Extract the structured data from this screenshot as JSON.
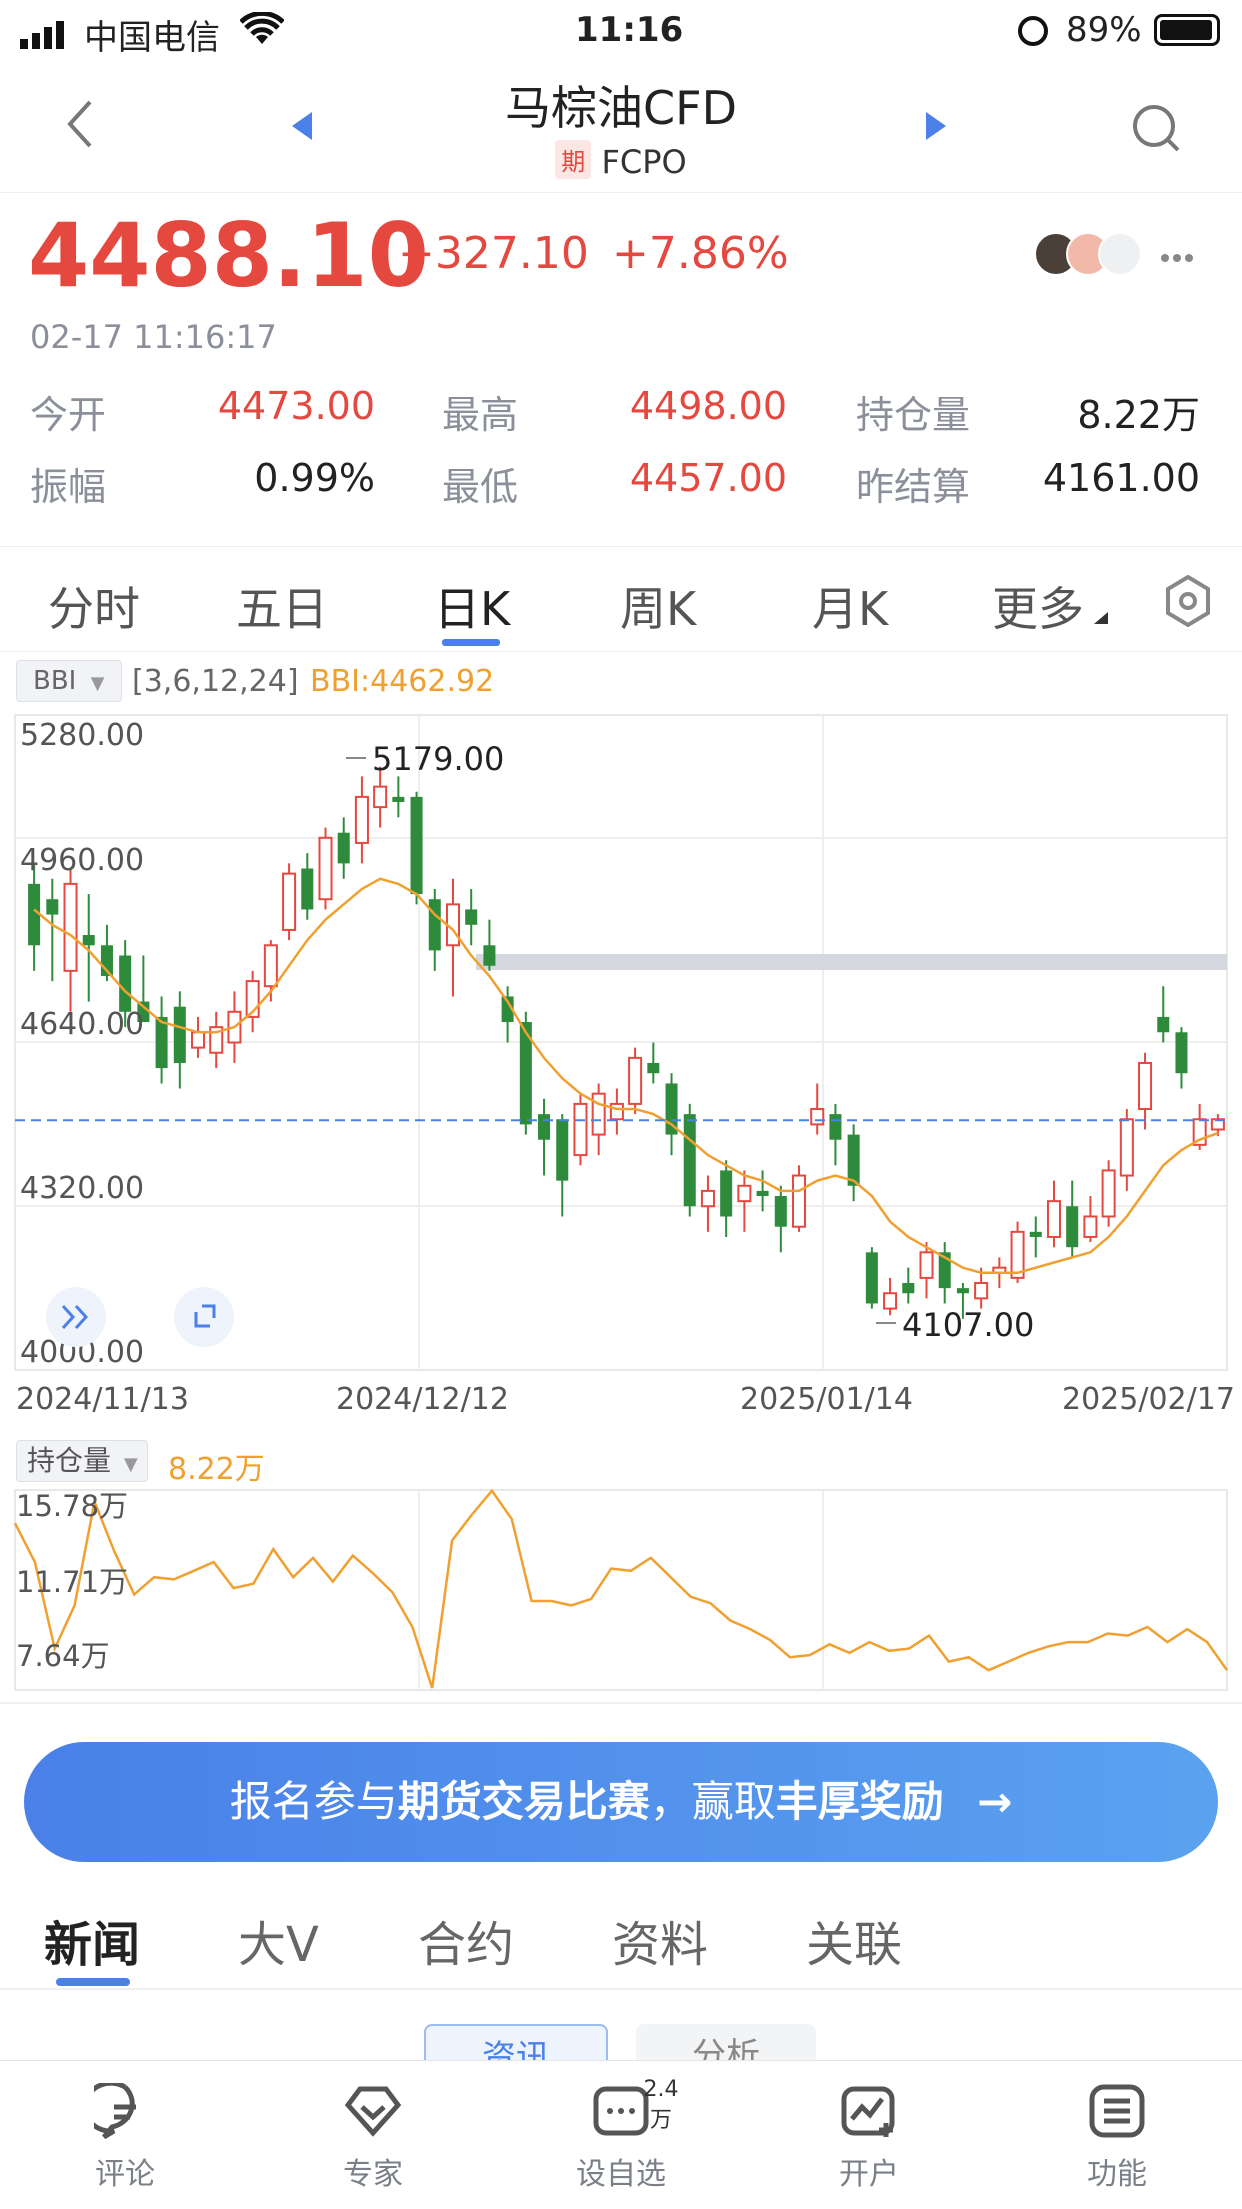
{
  "status_bar": {
    "carrier": "中国电信",
    "time": "11:16",
    "battery": "89%"
  },
  "header": {
    "title": "马棕油CFD",
    "badge": "期",
    "code": "FCPO"
  },
  "quote": {
    "price": "4488.10",
    "change": "+327.10",
    "change_pct": "+7.86%",
    "datetime": "02-17 11:16:17",
    "stats": [
      {
        "label": "今开",
        "value": "4473.00",
        "color": "#e5483f"
      },
      {
        "label": "最高",
        "value": "4498.00",
        "color": "#e5483f"
      },
      {
        "label": "持仓量",
        "value": "8.22万",
        "color": "#222222"
      },
      {
        "label": "振幅",
        "value": "0.99%",
        "color": "#222222"
      },
      {
        "label": "最低",
        "value": "4457.00",
        "color": "#e5483f"
      },
      {
        "label": "昨结算",
        "value": "4161.00",
        "color": "#222222"
      }
    ],
    "more_icon": "ellipsis-icon"
  },
  "period_tabs": [
    "分时",
    "五日",
    "日K",
    "周K",
    "月K",
    "更多"
  ],
  "active_tab": "日K",
  "indicator": {
    "name": "BBI",
    "params": "[3,6,12,24]",
    "value": "BBI:4462.92"
  },
  "volume_indicator": {
    "name": "持仓量",
    "value": "8.22万"
  },
  "colors": {
    "up": "#e5483f",
    "down": "#2e8b3c",
    "bbi": "#f0a030",
    "accent": "#4a80e8"
  },
  "chart_data": [
    {
      "type": "candlestick",
      "y_ticks": [
        "5280.00",
        "4960.00",
        "4640.00",
        "4320.00",
        "4000.00"
      ],
      "ylim": [
        4000,
        5280
      ],
      "x_ticks": [
        "2024/11/13",
        "2024/12/12",
        "2025/01/14",
        "2025/02/17"
      ],
      "high_label": "5179.00",
      "low_label": "4107.00",
      "current_price": 4488.1,
      "candles": [
        [
          4950,
          4830,
          4990,
          4780
        ],
        [
          4920,
          4890,
          4960,
          4760
        ],
        [
          4780,
          4950,
          4980,
          4700
        ],
        [
          4850,
          4830,
          4930,
          4720
        ],
        [
          4830,
          4770,
          4870,
          4760
        ],
        [
          4810,
          4700,
          4840,
          4670
        ],
        [
          4720,
          4680,
          4810,
          4680
        ],
        [
          4690,
          4590,
          4730,
          4560
        ],
        [
          4710,
          4600,
          4740,
          4550
        ],
        [
          4630,
          4660,
          4690,
          4610
        ],
        [
          4620,
          4670,
          4700,
          4590
        ],
        [
          4640,
          4700,
          4740,
          4600
        ],
        [
          4690,
          4760,
          4780,
          4660
        ],
        [
          4750,
          4830,
          4840,
          4720
        ],
        [
          4860,
          4970,
          4990,
          4840
        ],
        [
          4980,
          4900,
          5010,
          4880
        ],
        [
          4920,
          5040,
          5060,
          4900
        ],
        [
          5050,
          4990,
          5080,
          4960
        ],
        [
          5030,
          5120,
          5160,
          4990
        ],
        [
          5100,
          5140,
          5179,
          5060
        ],
        [
          5120,
          5110,
          5160,
          5080
        ],
        [
          5120,
          4930,
          5130,
          4910
        ],
        [
          4920,
          4820,
          4940,
          4780
        ],
        [
          4830,
          4910,
          4960,
          4730
        ],
        [
          4900,
          4870,
          4940,
          4830
        ],
        [
          4830,
          4790,
          4880,
          4780
        ],
        [
          4730,
          4680,
          4750,
          4640
        ],
        [
          4680,
          4480,
          4700,
          4460
        ],
        [
          4500,
          4450,
          4530,
          4380
        ],
        [
          4490,
          4370,
          4500,
          4300
        ],
        [
          4420,
          4520,
          4540,
          4400
        ],
        [
          4460,
          4540,
          4560,
          4420
        ],
        [
          4490,
          4520,
          4550,
          4460
        ],
        [
          4520,
          4610,
          4630,
          4500
        ],
        [
          4600,
          4580,
          4640,
          4560
        ],
        [
          4560,
          4460,
          4580,
          4420
        ],
        [
          4500,
          4320,
          4520,
          4300
        ],
        [
          4320,
          4350,
          4380,
          4270
        ],
        [
          4390,
          4300,
          4410,
          4260
        ],
        [
          4330,
          4360,
          4390,
          4270
        ],
        [
          4350,
          4340,
          4390,
          4310
        ],
        [
          4340,
          4280,
          4360,
          4230
        ],
        [
          4280,
          4380,
          4400,
          4270
        ],
        [
          4480,
          4510,
          4560,
          4460
        ],
        [
          4500,
          4450,
          4520,
          4400
        ],
        [
          4460,
          4360,
          4480,
          4330
        ],
        [
          4230,
          4130,
          4240,
          4120
        ],
        [
          4120,
          4150,
          4180,
          4107
        ],
        [
          4170,
          4150,
          4200,
          4130
        ],
        [
          4180,
          4230,
          4250,
          4140
        ],
        [
          4230,
          4160,
          4250,
          4130
        ],
        [
          4160,
          4150,
          4170,
          4100
        ],
        [
          4140,
          4170,
          4200,
          4120
        ],
        [
          4190,
          4200,
          4220,
          4160
        ],
        [
          4180,
          4270,
          4290,
          4170
        ],
        [
          4270,
          4260,
          4300,
          4220
        ],
        [
          4260,
          4330,
          4370,
          4240
        ],
        [
          4320,
          4240,
          4370,
          4220
        ],
        [
          4260,
          4300,
          4340,
          4250
        ],
        [
          4300,
          4390,
          4410,
          4280
        ],
        [
          4380,
          4490,
          4510,
          4350
        ],
        [
          4510,
          4600,
          4620,
          4470
        ],
        [
          4690,
          4660,
          4750,
          4640
        ],
        [
          4660,
          4580,
          4670,
          4550
        ],
        [
          4440,
          4490,
          4520,
          4430
        ],
        [
          4470,
          4490,
          4500,
          4457
        ]
      ],
      "bbi": [
        4900,
        4870,
        4850,
        4820,
        4780,
        4740,
        4710,
        4680,
        4670,
        4660,
        4660,
        4670,
        4700,
        4740,
        4790,
        4840,
        4880,
        4910,
        4940,
        4960,
        4950,
        4930,
        4890,
        4860,
        4810,
        4770,
        4720,
        4660,
        4610,
        4570,
        4540,
        4520,
        4510,
        4510,
        4500,
        4480,
        4450,
        4420,
        4400,
        4380,
        4370,
        4350,
        4350,
        4370,
        4380,
        4370,
        4340,
        4290,
        4260,
        4240,
        4220,
        4200,
        4190,
        4190,
        4190,
        4200,
        4210,
        4220,
        4230,
        4260,
        4300,
        4350,
        4400,
        4430,
        4450,
        4462.92
      ]
    },
    {
      "type": "line",
      "name": "持仓量",
      "y_ticks": [
        "15.78万",
        "11.71万",
        "7.64万"
      ],
      "ylim": [
        7.64,
        15.78
      ],
      "values": [
        14.8,
        13.0,
        9.0,
        11.0,
        15.8,
        13.5,
        11.5,
        12.3,
        12.2,
        12.6,
        13.0,
        11.8,
        12.0,
        13.6,
        12.3,
        13.2,
        12.1,
        13.3,
        12.5,
        11.6,
        10.0,
        6.8,
        14.0,
        15.2,
        16.3,
        15.0,
        11.2,
        11.2,
        11.0,
        11.3,
        12.7,
        12.6,
        13.2,
        12.3,
        11.4,
        11.1,
        10.3,
        9.9,
        9.4,
        8.6,
        8.7,
        9.2,
        8.8,
        9.3,
        8.9,
        9.0,
        9.6,
        8.4,
        8.6,
        8.0,
        8.4,
        8.8,
        9.1,
        9.3,
        9.3,
        9.7,
        9.6,
        10.0,
        9.3,
        9.9,
        9.3,
        8.0
      ]
    }
  ],
  "promo": {
    "text_a": "报名参与",
    "text_b": "期货交易比赛",
    "text_c": "，赢取",
    "text_d": "丰厚奖励",
    "arrow": "→"
  },
  "news_tabs": [
    "新闻",
    "大V",
    "合约",
    "资料",
    "关联"
  ],
  "sub_tabs": [
    "资讯",
    "分析"
  ],
  "bottom_nav": [
    {
      "label": "评论",
      "icon": "comment-icon"
    },
    {
      "label": "专家",
      "icon": "expert-icon"
    },
    {
      "label": "设自选",
      "icon": "add-watchlist-icon",
      "badge": "2.4万"
    },
    {
      "label": "开户",
      "icon": "open-account-icon"
    },
    {
      "label": "功能",
      "icon": "menu-icon"
    }
  ]
}
